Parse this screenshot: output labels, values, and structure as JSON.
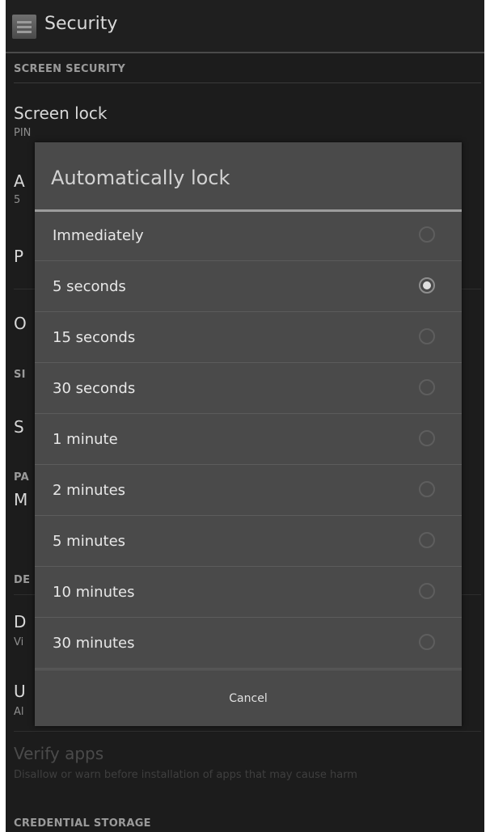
{
  "app": {
    "title": "Security"
  },
  "sections": {
    "screen_security": "SCREEN SECURITY",
    "credential_storage": "CREDENTIAL STORAGE"
  },
  "background_items": {
    "screen_lock": {
      "title": "Screen lock",
      "subtitle": "PIN"
    },
    "auto_lock": {
      "title_fragment": "A",
      "sub_fragment": "5"
    },
    "power_lock": {
      "title_fragment": "P"
    },
    "owner_info": {
      "title_fragment": "O"
    },
    "sim_header": {
      "fragment": "SI"
    },
    "sim_item": {
      "title_fragment": "S"
    },
    "pass_header": {
      "fragment": "PA"
    },
    "make_pass": {
      "title_fragment": "M"
    },
    "device_header": {
      "fragment": "DE"
    },
    "device_admin": {
      "title_fragment": "D",
      "sub_fragment": "Vi"
    },
    "unknown": {
      "title_fragment": "U",
      "sub_fragment": "Al"
    },
    "verify_apps": {
      "title": "Verify apps",
      "subtitle": "Disallow or warn before installation of apps that may cause harm"
    }
  },
  "dialog": {
    "title": "Automatically lock",
    "options": [
      {
        "label": "Immediately",
        "checked": false
      },
      {
        "label": "5 seconds",
        "checked": true
      },
      {
        "label": "15 seconds",
        "checked": false
      },
      {
        "label": "30 seconds",
        "checked": false
      },
      {
        "label": "1 minute",
        "checked": false
      },
      {
        "label": "2 minutes",
        "checked": false
      },
      {
        "label": "5 minutes",
        "checked": false
      },
      {
        "label": "10 minutes",
        "checked": false
      },
      {
        "label": "30 minutes",
        "checked": false
      }
    ],
    "cancel_label": "Cancel"
  }
}
